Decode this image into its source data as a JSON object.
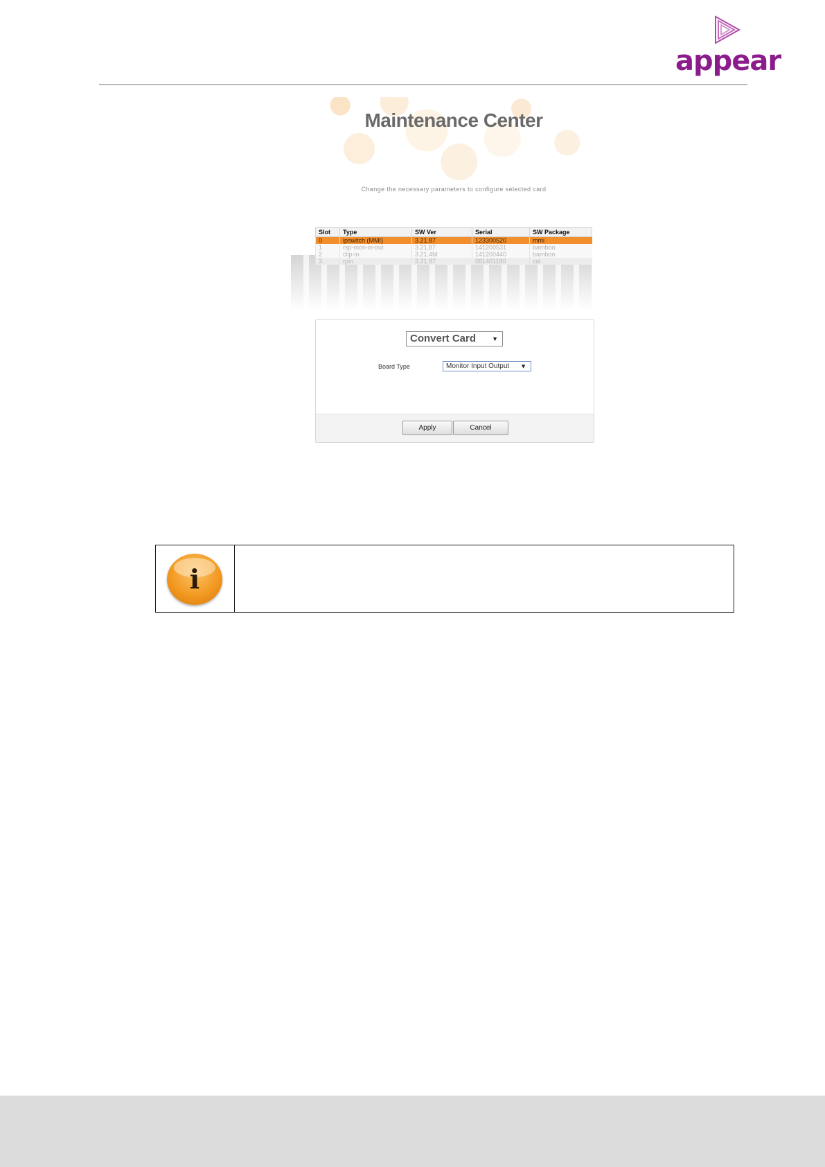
{
  "brand": {
    "logo_text": "appear",
    "colors": {
      "logo": "#8c1c8c",
      "accent": "#f28f2c"
    }
  },
  "screen": {
    "title": "Maintenance Center",
    "subtitle": "Change the necessary parameters to configure selected card",
    "table": {
      "columns": [
        "Slot",
        "Type",
        "SW Ver",
        "Serial",
        "SW Package"
      ],
      "rows": [
        [
          "0",
          "ipswitch (MMI)",
          "3.21.87",
          "123300520",
          "mmi"
        ],
        [
          "1",
          "rsp-mon-in-out",
          "3.21.87",
          "141200531",
          "bamboo"
        ],
        [
          "2",
          "clip-in",
          "3.21.4M",
          "141200440",
          "bamboo"
        ],
        [
          "3",
          "rpin",
          "3.21.87",
          "081401180",
          "col"
        ]
      ],
      "selected_row": 0
    },
    "form": {
      "action_select": "Convert Card",
      "board_type_label": "Board Type",
      "board_type_value": "Monitor Input Output",
      "apply_label": "Apply",
      "cancel_label": "Cancel"
    }
  },
  "info_box": {
    "icon": "info-icon",
    "icon_glyph": "i",
    "text": ""
  }
}
